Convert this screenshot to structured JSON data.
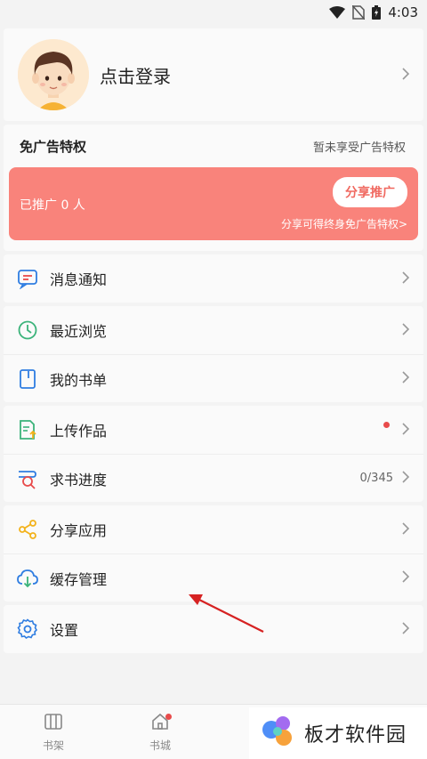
{
  "status_bar": {
    "time": "4:03"
  },
  "profile": {
    "login_text": "点击登录"
  },
  "ad_privilege": {
    "title": "免广告特权",
    "status": "暂未享受广告特权",
    "promoted_count": "已推广 0 人",
    "share_button": "分享推广",
    "note": "分享可得终身免广告特权>"
  },
  "menu_groups": [
    [
      {
        "label": "消息通知",
        "icon": "message-icon"
      }
    ],
    [
      {
        "label": "最近浏览",
        "icon": "clock-icon"
      },
      {
        "label": "我的书单",
        "icon": "booklist-icon"
      }
    ],
    [
      {
        "label": "上传作品",
        "icon": "upload-icon"
      },
      {
        "label": "求书进度",
        "icon": "search-book-icon",
        "value": "0/345"
      }
    ],
    [
      {
        "label": "分享应用",
        "icon": "share-icon"
      },
      {
        "label": "缓存管理",
        "icon": "cloud-download-icon"
      }
    ],
    [
      {
        "label": "设置",
        "icon": "gear-icon"
      }
    ]
  ],
  "bottom_nav": [
    {
      "label": "书架",
      "icon": "bookshelf-icon"
    },
    {
      "label": "书城",
      "icon": "home-icon"
    }
  ],
  "watermark": {
    "text": "板才软件园"
  },
  "colors": {
    "promo_banner": "#f9837b",
    "accent_red": "#e84b4b",
    "icon_green": "#3bb37a",
    "icon_blue": "#2f7de1",
    "icon_orange": "#f3b21b"
  }
}
